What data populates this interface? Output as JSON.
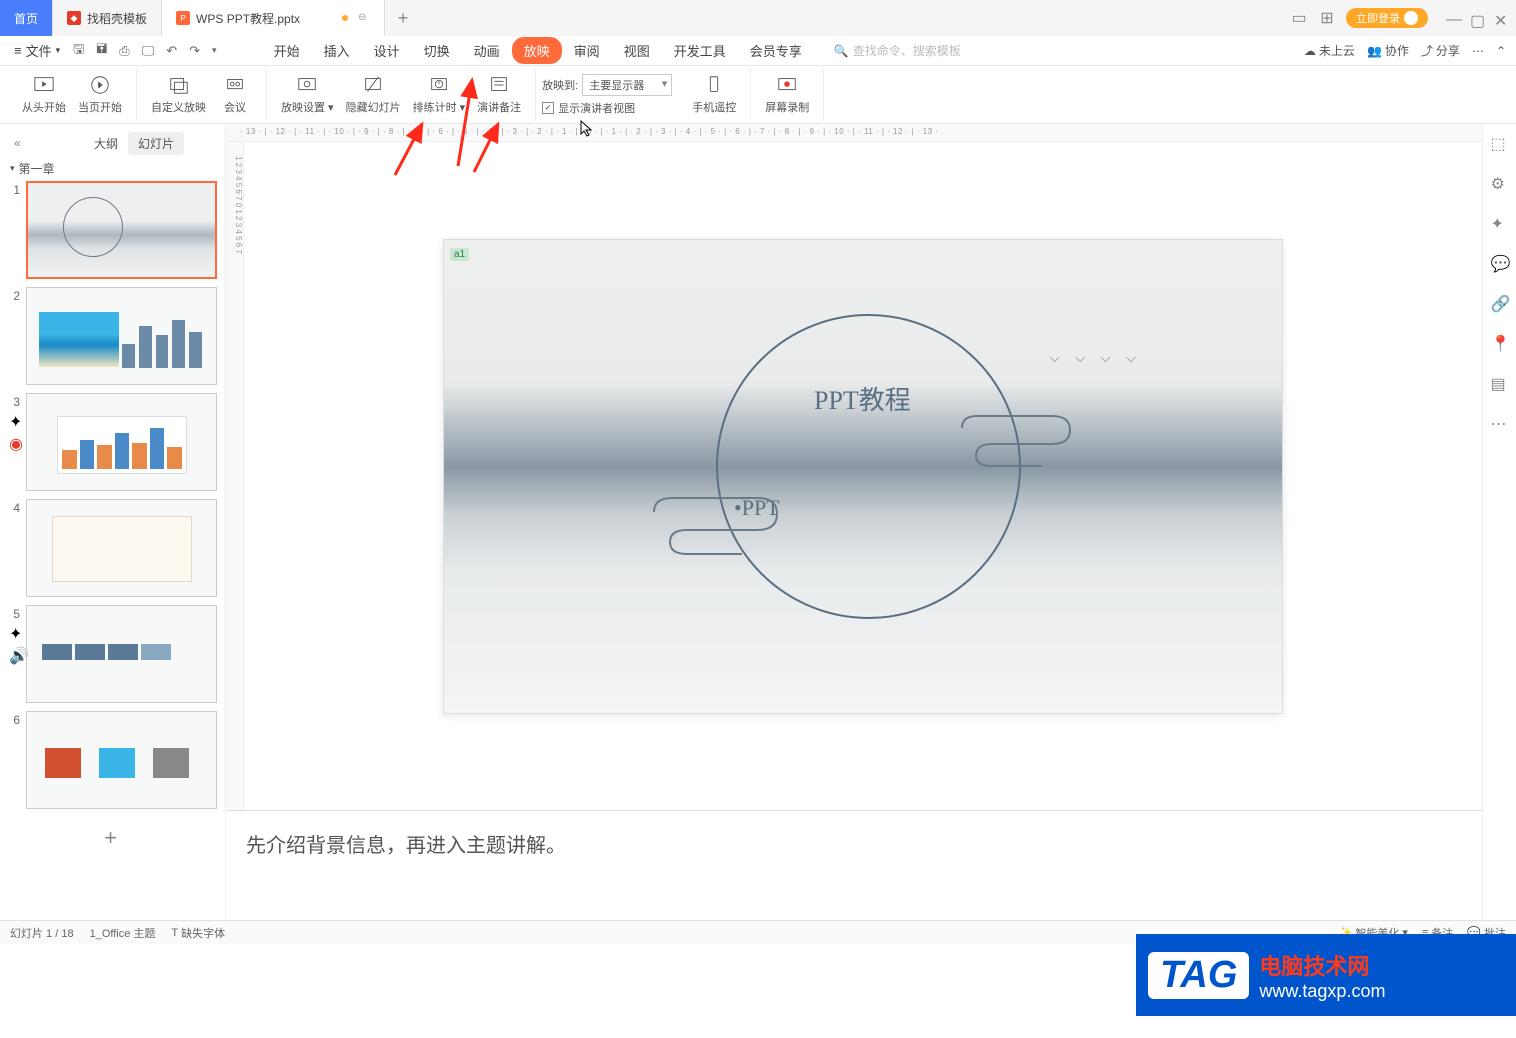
{
  "tabs": {
    "home": "首页",
    "template": "找稻壳模板",
    "current": "WPS PPT教程.pptx"
  },
  "login": "立即登录",
  "file_menu": "文件",
  "menu_tabs": [
    "开始",
    "插入",
    "设计",
    "切换",
    "动画",
    "放映",
    "审阅",
    "视图",
    "开发工具",
    "会员专享"
  ],
  "menu_active": "放映",
  "search_placeholder": "查找命令、搜索模板",
  "menu_right": {
    "cloud": "未上云",
    "coop": "协作",
    "share": "分享"
  },
  "ribbon": {
    "from_start": "从头开始",
    "from_current": "当页开始",
    "custom": "自定义放映",
    "meeting": "会议",
    "settings": "放映设置",
    "hide": "隐藏幻灯片",
    "rehearse": "排练计时",
    "notes": "演讲备注",
    "display_to": "放映到:",
    "display_value": "主要显示器",
    "presenter_view": "显示演讲者视图",
    "phone": "手机遥控",
    "record": "屏幕录制"
  },
  "outline": {
    "outline_tab": "大纲",
    "slides_tab": "幻灯片",
    "chapter": "第一章"
  },
  "slide_numbers": [
    "1",
    "2",
    "3",
    "4",
    "5",
    "6"
  ],
  "slide_content": {
    "marker": "a1",
    "title": "PPT教程",
    "subtitle": "•PPT"
  },
  "notes": "先介绍背景信息，再进入主题讲解。",
  "status": {
    "slide_count": "幻灯片 1 / 18",
    "theme": "1_Office 主题",
    "missing_font": "缺失字体",
    "beautify": "智能美化",
    "notes_btn": "备注",
    "approve": "批注"
  },
  "watermark": {
    "tag": "TAG",
    "line1": "电脑技术网",
    "line2": "www.tagxp.com"
  },
  "ruler_top": "· 13 · | · 12 · | · 11 · | · 10 · | · 9 · | · 8 · | · 7 · | · 6 · | · 5 · | · 4 · | · 3 · | · 2 · | · 1 · | · 0 · | · 1 · | · 2 · | · 3 · | · 4 · | · 5 · | · 6 · | · 7 · | · 8 · | · 9 · | · 10 · | · 11 · | · 12 · | · 13 ·",
  "ruler_left": "1 2 3 4 5 6 7 0 1 2 3 4 5 6 7"
}
